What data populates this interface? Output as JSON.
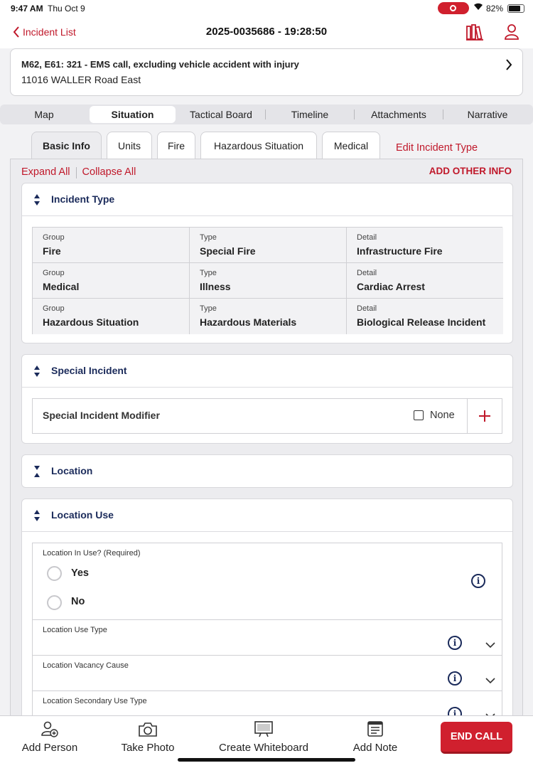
{
  "status_bar": {
    "time": "9:47 AM",
    "date": "Thu Oct 9",
    "battery": "82%"
  },
  "nav": {
    "back_label": "Incident List",
    "title": "2025-0035686 - 19:28:50"
  },
  "incident": {
    "units_line": "M62, E61: 321 - EMS call, excluding vehicle accident with injury",
    "address": "11016 WALLER Road East"
  },
  "tabs": [
    "Map",
    "Situation",
    "Tactical Board",
    "Timeline",
    "Attachments",
    "Narrative"
  ],
  "active_tab": "Situation",
  "subtabs": [
    "Basic Info",
    "Units",
    "Fire",
    "Hazardous Situation",
    "Medical"
  ],
  "active_subtab": "Basic Info",
  "edit_incident_type": "Edit Incident Type",
  "expand_all": "Expand All",
  "collapse_all": "Collapse All",
  "add_other_info": "ADD OTHER INFO",
  "incident_type": {
    "title": "Incident Type",
    "rows": [
      {
        "group_label": "Group",
        "group": "Fire",
        "type_label": "Type",
        "type": "Special Fire",
        "detail_label": "Detail",
        "detail": "Infrastructure Fire"
      },
      {
        "group_label": "Group",
        "group": "Medical",
        "type_label": "Type",
        "type": "Illness",
        "detail_label": "Detail",
        "detail": "Cardiac Arrest"
      },
      {
        "group_label": "Group",
        "group": "Hazardous Situation",
        "type_label": "Type",
        "type": "Hazardous Materials",
        "detail_label": "Detail",
        "detail": "Biological Release Incident"
      }
    ]
  },
  "special_incident": {
    "title": "Special Incident",
    "modifier_label": "Special Incident Modifier",
    "none_label": "None"
  },
  "location": {
    "title": "Location"
  },
  "location_use": {
    "title": "Location Use",
    "in_use_label": "Location In Use? (Required)",
    "yes": "Yes",
    "no": "No",
    "use_type_label": "Location Use Type",
    "vacancy_label": "Location Vacancy Cause",
    "secondary_label": "Location Secondary Use Type"
  },
  "bottom_bar": {
    "add_person": "Add Person",
    "take_photo": "Take Photo",
    "create_whiteboard": "Create Whiteboard",
    "add_note": "Add Note",
    "end_call": "END CALL"
  },
  "colors": {
    "accent_red": "#c0182a",
    "navy": "#1a2a5a",
    "end_call_bg": "#d0202e"
  }
}
